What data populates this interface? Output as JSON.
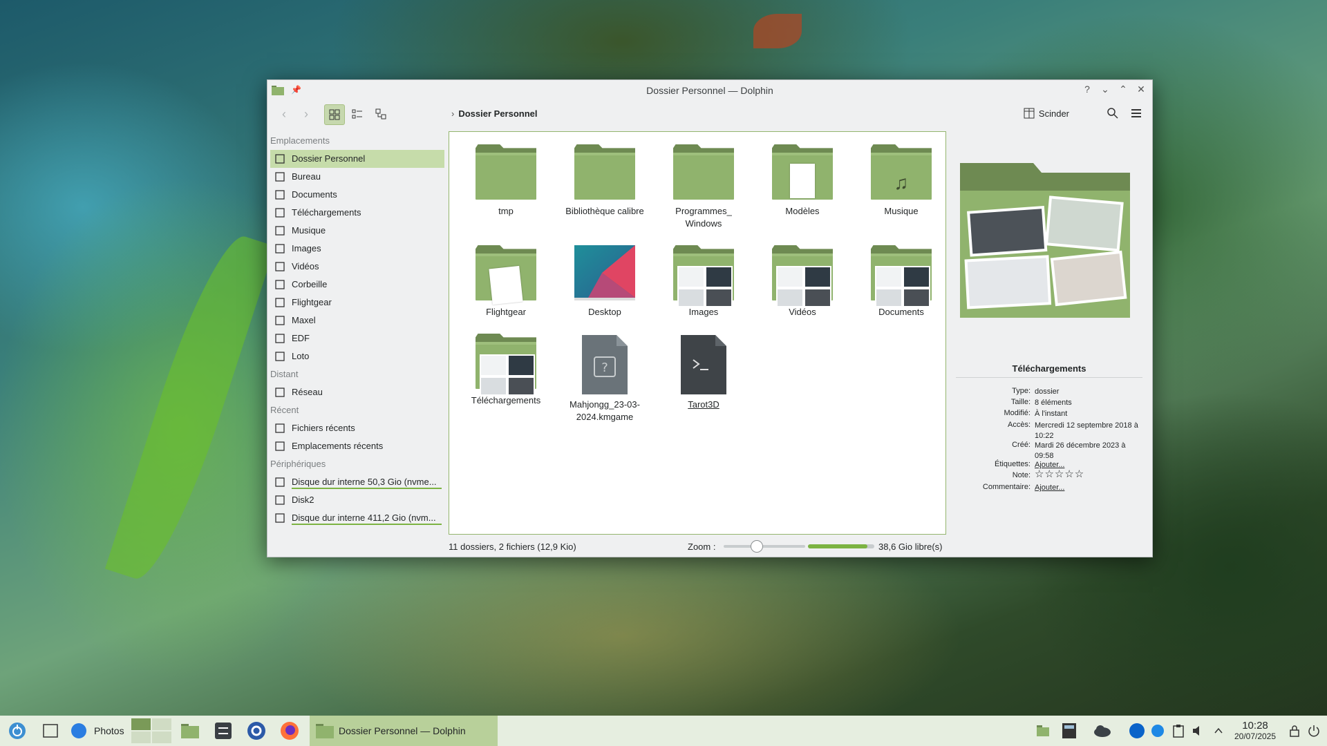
{
  "window": {
    "title": "Dossier Personnel — Dolphin",
    "breadcrumb": "Dossier Personnel",
    "split_label": "Scinder"
  },
  "sidebar": {
    "sections": [
      {
        "label": "Emplacements"
      },
      {
        "label": "Distant"
      },
      {
        "label": "Récent"
      },
      {
        "label": "Périphériques"
      }
    ],
    "places": [
      {
        "label": "Dossier Personnel",
        "icon": "home-icon"
      },
      {
        "label": "Bureau",
        "icon": "desktop-icon"
      },
      {
        "label": "Documents",
        "icon": "document-icon"
      },
      {
        "label": "Téléchargements",
        "icon": "download-icon"
      },
      {
        "label": "Musique",
        "icon": "music-icon"
      },
      {
        "label": "Images",
        "icon": "image-icon"
      },
      {
        "label": "Vidéos",
        "icon": "video-icon"
      },
      {
        "label": "Corbeille",
        "icon": "trash-icon"
      },
      {
        "label": "Flightgear",
        "icon": "folder-icon"
      },
      {
        "label": "Maxel",
        "icon": "folder-icon"
      },
      {
        "label": "EDF",
        "icon": "folder-icon"
      },
      {
        "label": "Loto",
        "icon": "folder-icon"
      }
    ],
    "remote": [
      {
        "label": "Réseau",
        "icon": "network-icon"
      }
    ],
    "recent": [
      {
        "label": "Fichiers récents",
        "icon": "recent-files-icon"
      },
      {
        "label": "Emplacements récents",
        "icon": "recent-places-icon"
      }
    ],
    "devices": [
      {
        "label": "Disque dur interne 50,3 Gio (nvme...",
        "icon": "drive-icon"
      },
      {
        "label": "Disk2",
        "icon": "drive-icon"
      },
      {
        "label": "Disque dur interne 411,2 Gio (nvm...",
        "icon": "drive-icon"
      }
    ]
  },
  "files": [
    {
      "name": "tmp",
      "kind": "folder"
    },
    {
      "name": "Bibliothèque calibre",
      "kind": "folder"
    },
    {
      "name": "Programmes_\nWindows",
      "kind": "folder"
    },
    {
      "name": "Modèles",
      "kind": "folder"
    },
    {
      "name": "Musique",
      "kind": "folder"
    },
    {
      "name": "Flightgear",
      "kind": "folder"
    },
    {
      "name": "Desktop",
      "kind": "folder"
    },
    {
      "name": "Images",
      "kind": "folder"
    },
    {
      "name": "Vidéos",
      "kind": "folder"
    },
    {
      "name": "Documents",
      "kind": "folder"
    },
    {
      "name": "Téléchargements",
      "kind": "folder"
    },
    {
      "name": "Mahjongg_23-03-\n2024.kmgame",
      "kind": "file"
    },
    {
      "name": "Tarot3D",
      "kind": "file"
    }
  ],
  "info": {
    "title": "Téléchargements",
    "rows": [
      {
        "label": "Type:",
        "value": "dossier"
      },
      {
        "label": "Taille:",
        "value": "8 éléments"
      },
      {
        "label": "Modifié:",
        "value": "À l'instant"
      },
      {
        "label": "Accès:",
        "value": "Mercredi 12 septembre 2018 à 10:22"
      },
      {
        "label": "Créé:",
        "value": "Mardi 26 décembre 2023 à 09:58"
      },
      {
        "label": "Étiquettes:",
        "value": "Ajouter..."
      },
      {
        "label": "Note:",
        "value": "☆☆☆☆☆"
      },
      {
        "label": "Commentaire:",
        "value": "Ajouter..."
      }
    ]
  },
  "status": {
    "summary": "11 dossiers, 2 fichiers (12,9 Kio)",
    "zoom_label": "Zoom :",
    "zoom_value": 0.4,
    "free_space": "38,6 Gio libre(s)",
    "free_fraction": 0.9
  },
  "taskbar": {
    "photos_label": "Photos",
    "active_task": "Dossier Personnel — Dolphin",
    "time": "10:28",
    "date": "20/07/2025"
  },
  "colors": {
    "accent": "#7cb342",
    "folder": "#90b36d",
    "selection": "#c6dcaa"
  }
}
